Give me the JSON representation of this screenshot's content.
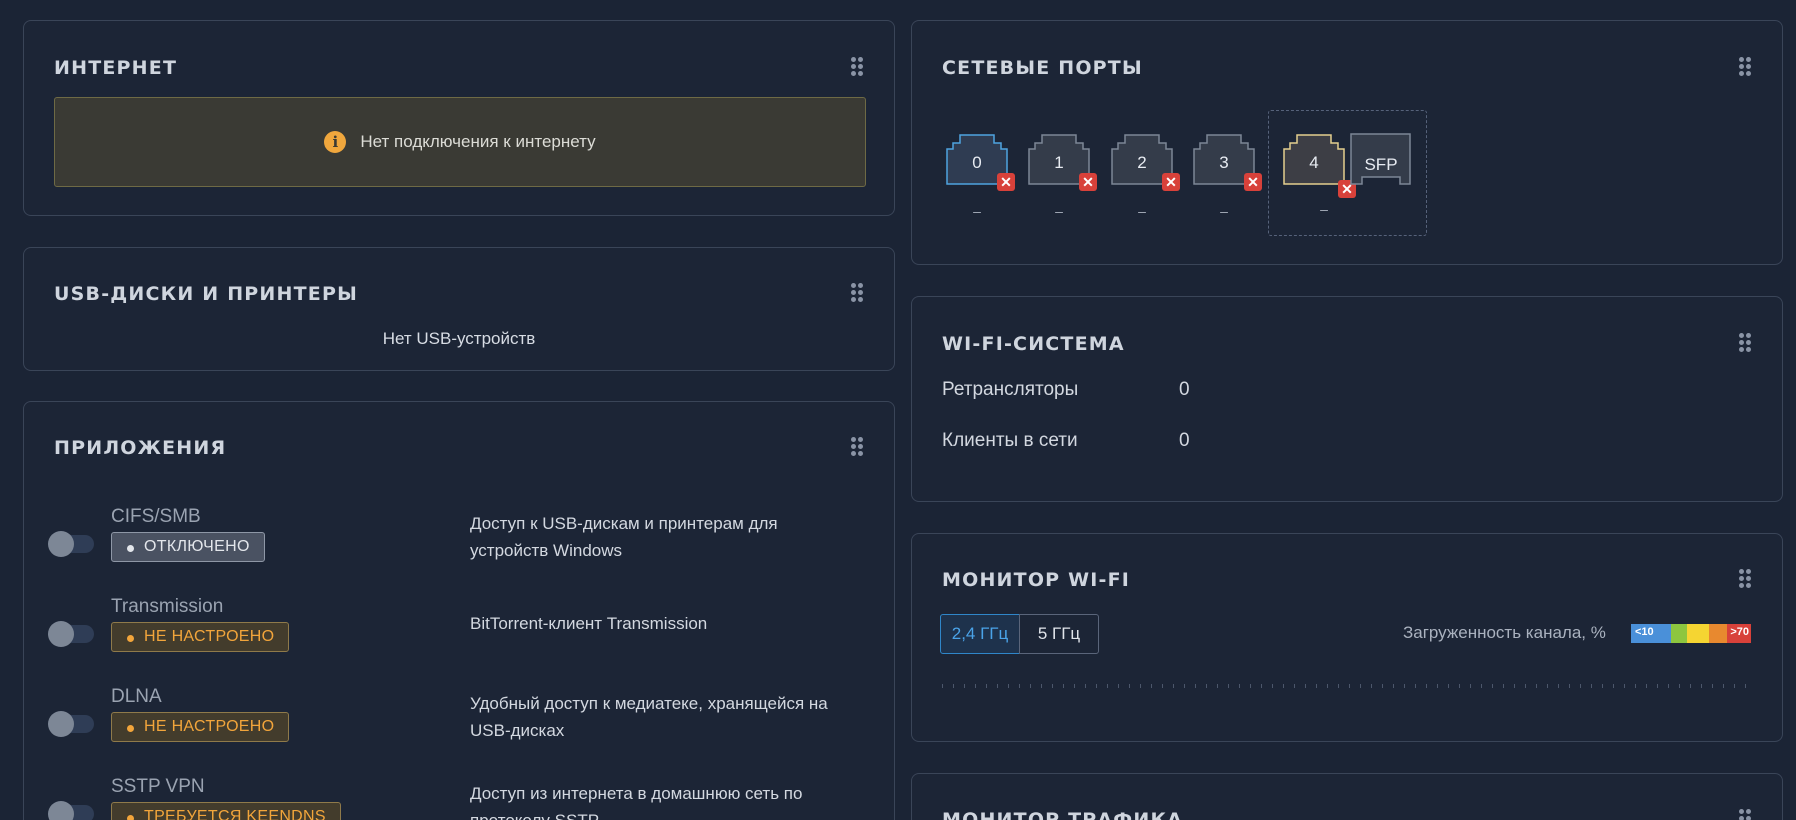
{
  "internet": {
    "title": "ИНТЕРНЕТ",
    "alert_text": "Нет подключения к интернету",
    "alert_icon": "info-icon"
  },
  "usb": {
    "title": "USB-ДИСКИ И ПРИНТЕРЫ",
    "empty_text": "Нет USB-устройств"
  },
  "apps": {
    "title": "ПРИЛОЖЕНИЯ",
    "items": [
      {
        "name": "CIFS/SMB",
        "status": "ОТКЛЮЧЕНО",
        "status_type": "off",
        "description": "Доступ к USB-дискам и принтерам для устройств Windows"
      },
      {
        "name": "Transmission",
        "status": "НЕ НАСТРОЕНО",
        "status_type": "warn",
        "description": "BitTorrent-клиент Transmission"
      },
      {
        "name": "DLNA",
        "status": "НЕ НАСТРОЕНО",
        "status_type": "warn",
        "description": "Удобный доступ к медиатеке, хранящейся на USB-дисках"
      },
      {
        "name": "SSTP VPN",
        "status": "ТРЕБУЕТСЯ KEENDNS",
        "status_type": "warn",
        "description": "Доступ из интернета в домашнюю сеть по протоколу SSTP"
      }
    ]
  },
  "ports": {
    "title": "СЕТЕВЫЕ ПОРТЫ",
    "items": [
      {
        "label": "0",
        "speed": "–",
        "state": "disconnected",
        "color": "#4ea3e0"
      },
      {
        "label": "1",
        "speed": "–",
        "state": "disconnected",
        "color": "#7d8796"
      },
      {
        "label": "2",
        "speed": "–",
        "state": "disconnected",
        "color": "#7d8796"
      },
      {
        "label": "3",
        "speed": "–",
        "state": "disconnected",
        "color": "#7d8796"
      },
      {
        "label": "4",
        "speed": "–",
        "state": "disconnected",
        "color": "#e3cf8e"
      }
    ],
    "sfp_label": "SFP"
  },
  "wifi_system": {
    "title": "WI-FI-СИСТЕМА",
    "rows": [
      {
        "label": "Ретрансляторы",
        "value": "0"
      },
      {
        "label": "Клиенты в сети",
        "value": "0"
      }
    ]
  },
  "wifi_monitor": {
    "title": "МОНИТОР WI-FI",
    "bands": [
      "2,4 ГГц",
      "5 ГГц"
    ],
    "active_band": "2,4 ГГц",
    "load_label": "Загруженность канала, %",
    "legend_min": "<10",
    "legend_max": ">70",
    "legend_colors": [
      "#4a90d9",
      "#8dc63f",
      "#f5d532",
      "#e8892f",
      "#d8413a"
    ]
  },
  "traffic": {
    "title": "МОНИТОР ТРАФИКА"
  }
}
